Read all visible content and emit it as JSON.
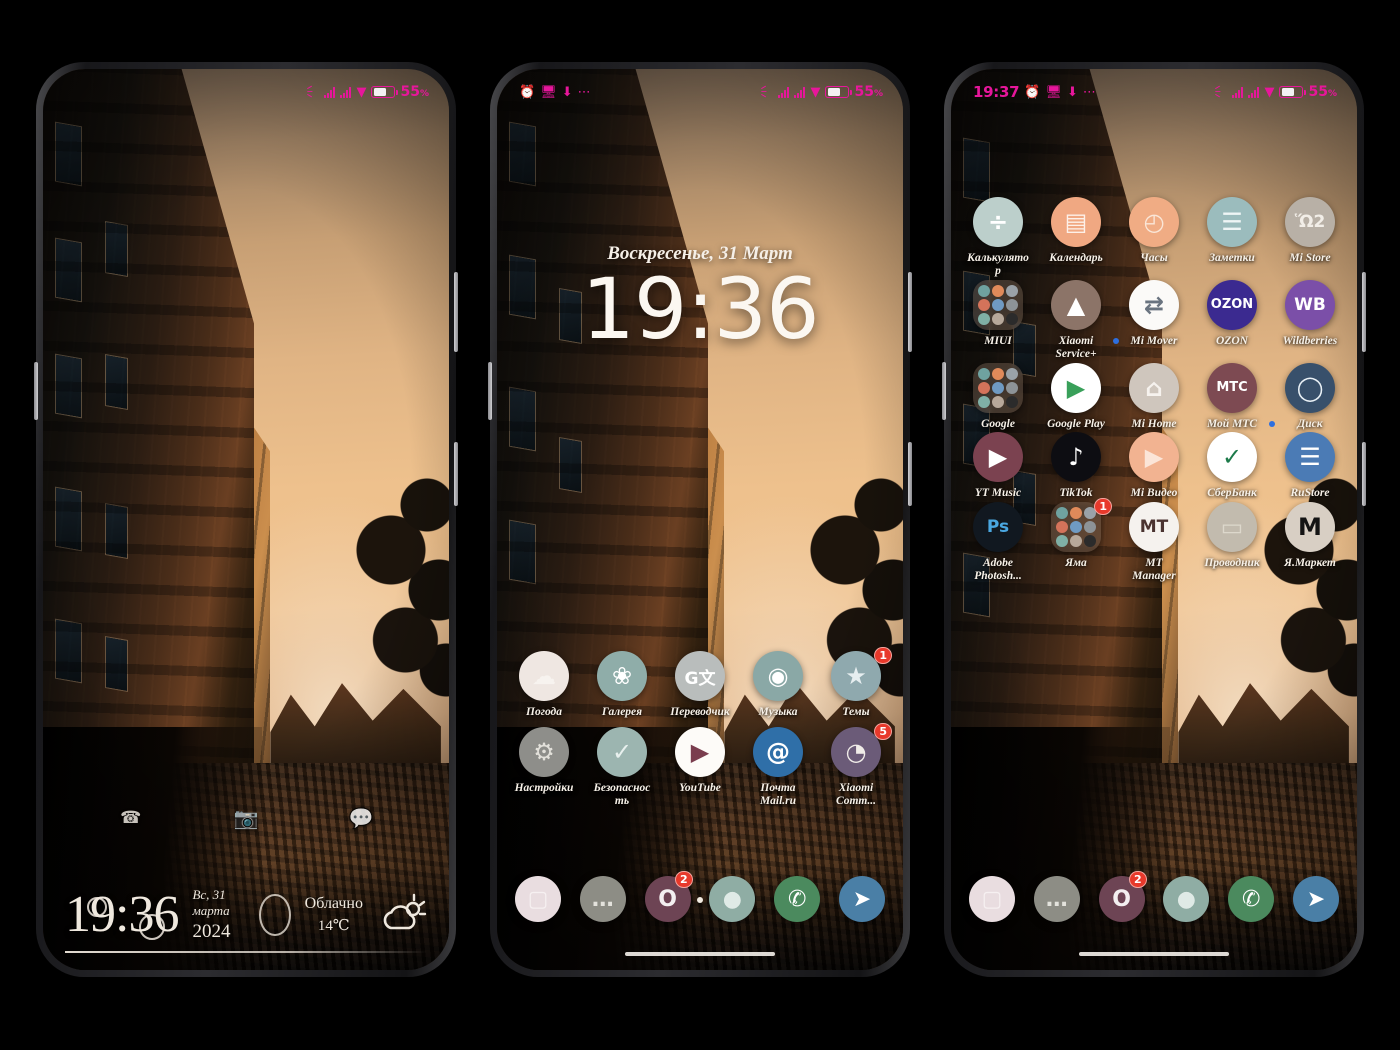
{
  "statusbar": {
    "battery_percent": "55",
    "battery_unit": "%",
    "bluetooth_icon": "bluetooth-icon",
    "phone1": {
      "left_items": []
    },
    "phone2": {
      "left_items": [
        "alarm-icon",
        "screenshot-icon",
        "download-icon",
        "more-dots"
      ]
    },
    "phone3": {
      "time": "19:37",
      "left_items": [
        "alarm-icon",
        "screenshot-icon",
        "download-icon",
        "more-dots"
      ]
    }
  },
  "lockscreen": {
    "shortcuts": [
      {
        "name": "phone-shortcut",
        "glyph": "☎"
      },
      {
        "name": "camera-shortcut",
        "glyph": "◉"
      },
      {
        "name": "message-shortcut",
        "glyph": "•••"
      }
    ],
    "widget": {
      "clock": "19:36",
      "date_day": "Вс, 31 марта",
      "date_year": "2024",
      "weather_text": "Облачно",
      "weather_temp": "14℃",
      "weather_icon": "partly-cloudy-icon"
    }
  },
  "homescreen": {
    "date_header": "Воскресенье, 31 Март",
    "clock": "19:36",
    "page_indicator": "1 of 1",
    "apps": [
      {
        "label": "Погода",
        "name": "app-weather",
        "icon": "weather-icon",
        "bg": "#efe7e2",
        "fg": "#f7f3ef",
        "glyph": "☁",
        "badge": ""
      },
      {
        "label": "Галерея",
        "name": "app-gallery",
        "icon": "gallery-flower-icon",
        "bg": "#8fada9",
        "fg": "#ffffff",
        "glyph": "❀",
        "badge": ""
      },
      {
        "label": "Переводчик",
        "name": "app-translate",
        "icon": "google-translate-icon",
        "bg": "#b9bdbc",
        "fg": "#ffffff",
        "glyph": "G文",
        "badge": ""
      },
      {
        "label": "Музыка",
        "name": "app-music",
        "icon": "vinyl-record-icon",
        "bg": "#8aa8a6",
        "fg": "#ffffff",
        "glyph": "◉",
        "badge": ""
      },
      {
        "label": "Темы",
        "name": "app-themes",
        "icon": "themes-star-icon",
        "bg": "#8fa9ae",
        "fg": "#e6eef0",
        "glyph": "★",
        "badge": "1"
      },
      {
        "label": "Настройки",
        "name": "app-settings",
        "icon": "gear-icon",
        "bg": "#8e8e8a",
        "fg": "#e2e0da",
        "glyph": "⚙",
        "badge": ""
      },
      {
        "label": "Безопасность",
        "name": "app-security",
        "icon": "shield-check-icon",
        "bg": "#9cb5b0",
        "fg": "#e8f0ee",
        "glyph": "✓",
        "badge": ""
      },
      {
        "label": "YouTube",
        "name": "app-youtube",
        "icon": "youtube-play-icon",
        "bg": "#fdfbf8",
        "fg": "#7a3d4e",
        "glyph": "▶",
        "badge": ""
      },
      {
        "label": "Почта Mail.ru",
        "name": "app-mailru",
        "icon": "mailru-at-icon",
        "bg": "#2f6fa8",
        "fg": "#ffffff",
        "glyph": "@",
        "badge": ""
      },
      {
        "label": "Xiaomi Comm...",
        "name": "app-xiaomi-community",
        "icon": "xiaomi-community-icon",
        "bg": "#6b5b78",
        "fg": "#f0ece8",
        "glyph": "◔",
        "badge": "5"
      }
    ],
    "dock": [
      {
        "name": "dock-camera",
        "icon": "camera-icon",
        "bg": "#e9dde0",
        "fg": "#f6f0f1",
        "glyph": "▢",
        "badge": ""
      },
      {
        "name": "dock-messages",
        "icon": "message-bubble-icon",
        "bg": "#8d8d85",
        "fg": "#e3e2dc",
        "glyph": "…",
        "badge": ""
      },
      {
        "name": "dock-opera",
        "icon": "opera-icon",
        "bg": "#6d4454",
        "fg": "#f3eff0",
        "glyph": "O",
        "badge": "2"
      },
      {
        "name": "dock-browser",
        "icon": "browser-icon",
        "bg": "#8fada4",
        "fg": "#dfeae6",
        "glyph": "●",
        "badge": ""
      },
      {
        "name": "dock-whatsapp",
        "icon": "whatsapp-icon",
        "bg": "#4b8a5e",
        "fg": "#ffffff",
        "glyph": "✆",
        "badge": ""
      },
      {
        "name": "dock-telegram",
        "icon": "telegram-icon",
        "bg": "#4a7fa6",
        "fg": "#ffffff",
        "glyph": "➤",
        "badge": ""
      }
    ]
  },
  "drawer": {
    "apps": [
      {
        "label": "Калькулятор",
        "name": "app-calculator",
        "icon": "calculator-icon",
        "bg": "#bccfcb",
        "fg": "#ffffff",
        "glyph": "÷",
        "badge": "",
        "folder": false
      },
      {
        "label": "Календарь",
        "name": "app-calendar",
        "icon": "calendar-icon",
        "bg": "#f0a882",
        "fg": "#fdf0e8",
        "glyph": "▤",
        "badge": "",
        "folder": false
      },
      {
        "label": "Часы",
        "name": "app-clock",
        "icon": "clock-icon",
        "bg": "#f0ac84",
        "fg": "#fae6d7",
        "glyph": "◴",
        "badge": "",
        "folder": false
      },
      {
        "label": "Заметки",
        "name": "app-notes",
        "icon": "notes-icon",
        "bg": "#9bbcbd",
        "fg": "#eef5f5",
        "glyph": "☰",
        "badge": "",
        "folder": false
      },
      {
        "label": "Mi Store",
        "name": "app-mi-store",
        "icon": "shopping-cart-icon",
        "bg": "#b8b0a6",
        "fg": "#f2eee8",
        "glyph": "Ὥ2",
        "badge": "",
        "folder": false
      },
      {
        "label": "MIUI",
        "name": "folder-miui",
        "icon": "folder-icon",
        "bg": "",
        "fg": "",
        "glyph": "",
        "badge": "",
        "folder": true
      },
      {
        "label": "Xiaomi Service+",
        "name": "app-xiaomi-service",
        "icon": "xiaomi-service-icon",
        "bg": "#8c7468",
        "fg": "#ffffff",
        "glyph": "▲",
        "badge": "",
        "folder": false
      },
      {
        "label": "Mi Mover",
        "name": "app-mi-mover",
        "icon": "mi-mover-icon",
        "bg": "#fbfaf8",
        "fg": "#6a7480",
        "glyph": "⇄",
        "badge": "",
        "folder": false,
        "dot": true
      },
      {
        "label": "OZON",
        "name": "app-ozon",
        "icon": "ozon-icon",
        "bg": "#3b2a90",
        "fg": "#ffffff",
        "glyph": "OZON",
        "badge": "",
        "folder": false
      },
      {
        "label": "Wildberries",
        "name": "app-wildberries",
        "icon": "wildberries-icon",
        "bg": "#7b4fa8",
        "fg": "#ffffff",
        "glyph": "WB",
        "badge": "",
        "folder": false
      },
      {
        "label": "Google",
        "name": "folder-google",
        "icon": "folder-icon",
        "bg": "",
        "fg": "",
        "glyph": "",
        "badge": "",
        "folder": true
      },
      {
        "label": "Google Play",
        "name": "app-google-play",
        "icon": "google-play-icon",
        "bg": "#ffffff",
        "fg": "#39a05a",
        "glyph": "▶",
        "badge": "",
        "folder": false
      },
      {
        "label": "Mi Home",
        "name": "app-mi-home",
        "icon": "home-icon",
        "bg": "#cfc6bd",
        "fg": "#f6f2ee",
        "glyph": "⌂",
        "badge": "",
        "folder": false
      },
      {
        "label": "Мой МТС",
        "name": "app-mts",
        "icon": "mts-icon",
        "bg": "#7d4a52",
        "fg": "#ffffff",
        "glyph": "МТС",
        "badge": "",
        "folder": false
      },
      {
        "label": "Диск",
        "name": "app-yandex-disk",
        "icon": "yandex-disk-icon",
        "bg": "#38506b",
        "fg": "#eaf1f6",
        "glyph": "◯",
        "badge": "",
        "folder": false,
        "dot": true
      },
      {
        "label": "YT Music",
        "name": "app-yt-music",
        "icon": "yt-music-icon",
        "bg": "#7b4250",
        "fg": "#ffffff",
        "glyph": "▶",
        "badge": "",
        "folder": false
      },
      {
        "label": "TikTok",
        "name": "app-tiktok",
        "icon": "tiktok-icon",
        "bg": "#0d0d12",
        "fg": "#ffffff",
        "glyph": "♪",
        "badge": "",
        "folder": false
      },
      {
        "label": "Mi Видео",
        "name": "app-mi-video",
        "icon": "mi-video-icon",
        "bg": "#f2b391",
        "fg": "#fbe5d8",
        "glyph": "▶",
        "badge": "",
        "folder": false
      },
      {
        "label": "СберБанк",
        "name": "app-sberbank",
        "icon": "sberbank-icon",
        "bg": "#ffffff",
        "fg": "#1d7a4a",
        "glyph": "✓",
        "badge": "",
        "folder": false
      },
      {
        "label": "RuStore",
        "name": "app-rustore",
        "icon": "rustore-icon",
        "bg": "#4b7bb5",
        "fg": "#ffffff",
        "glyph": "☰",
        "badge": "",
        "folder": false
      },
      {
        "label": "Adobe Photosh...",
        "name": "app-photoshop",
        "icon": "photoshop-icon",
        "bg": "#111820",
        "fg": "#4aa7e0",
        "glyph": "Ps",
        "badge": "",
        "folder": false
      },
      {
        "label": "Яма",
        "name": "folder-yama",
        "icon": "folder-icon",
        "bg": "",
        "fg": "",
        "glyph": "",
        "badge": "1",
        "folder": true
      },
      {
        "label": "MT Manager",
        "name": "app-mt-manager",
        "icon": "mt-manager-icon",
        "bg": "#f5f2ee",
        "fg": "#4a3330",
        "glyph": "MT",
        "badge": "",
        "folder": false
      },
      {
        "label": "Проводник",
        "name": "app-file-explorer",
        "icon": "folder-file-icon",
        "bg": "#c2bbae",
        "fg": "#ddd8cc",
        "glyph": "▭",
        "badge": "",
        "folder": false
      },
      {
        "label": "Я.Маркет",
        "name": "app-yandex-market",
        "icon": "yandex-market-icon",
        "bg": "#d8cfc4",
        "fg": "#141414",
        "glyph": "M",
        "badge": "",
        "folder": false
      }
    ]
  },
  "colors": {
    "status_accent": "#e7169b",
    "badge_red": "#e8392b",
    "label_text": "#f7f1e8"
  }
}
